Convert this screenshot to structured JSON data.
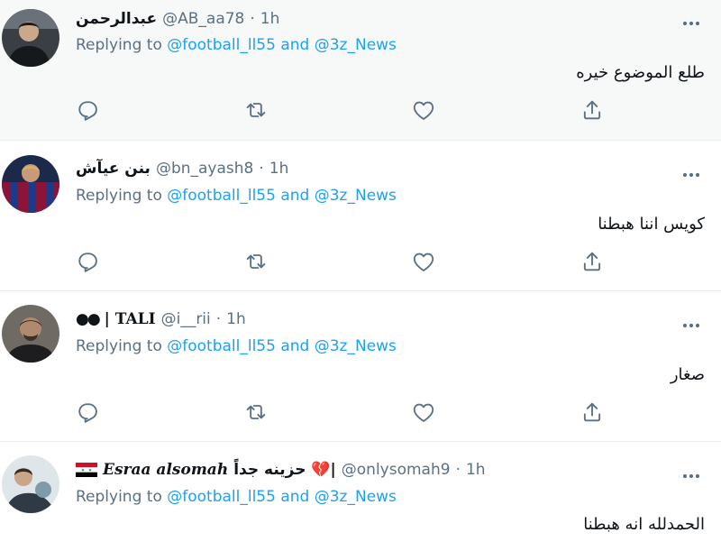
{
  "colors": {
    "text": "#0f1419",
    "muted": "#5b7083",
    "link": "#1da1f2",
    "border": "#e6ecf0",
    "highlight_bg": "#f7f9f9"
  },
  "tweets": [
    {
      "display_name": "عبدالرحمن",
      "handle": "@AB_aa78",
      "separator": "·",
      "time": "1h",
      "replying_prefix": "Replying to",
      "mention1": "@football_ll55",
      "and": "and",
      "mention2": "@3z_News",
      "text": "طلع الموضوع خيره",
      "avatar_icon": "user-avatar-icon"
    },
    {
      "display_name": "بنن عيآش",
      "handle": "@bn_ayash8",
      "separator": "·",
      "time": "1h",
      "replying_prefix": "Replying to",
      "mention1": "@football_ll55",
      "and": "and",
      "mention2": "@3z_News",
      "text": "كويس اننا هبطنا",
      "avatar_icon": "user-avatar-icon"
    },
    {
      "display_name_symbol": "●●",
      "display_name": "| TALI",
      "handle": "@i__rii",
      "separator": "·",
      "time": "1h",
      "replying_prefix": "Replying to",
      "mention1": "@football_ll55",
      "and": "and",
      "mention2": "@3z_News",
      "text": "صغار",
      "avatar_icon": "user-avatar-icon"
    },
    {
      "display_name_latin": "Esraa alsomah",
      "display_name_arabic": "|💔 حزينه جداً",
      "handle": "@onlysomah9",
      "separator": "·",
      "time": "1h",
      "replying_prefix": "Replying to",
      "mention1": "@football_ll55",
      "and": "and",
      "mention2": "@3z_News",
      "text": "الحمدلله انه هبطنا",
      "avatar_icon": "user-avatar-icon"
    }
  ],
  "icons": {
    "more": "more-horizontal-icon",
    "reply": "reply-icon",
    "retweet": "retweet-icon",
    "like": "heart-icon",
    "share": "share-icon"
  }
}
